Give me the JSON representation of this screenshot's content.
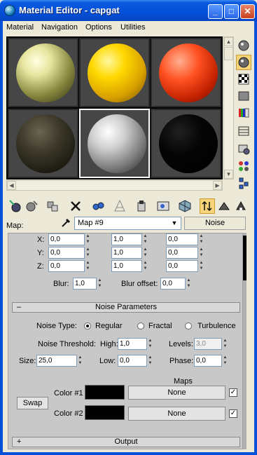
{
  "window": {
    "title": "Material Editor - capgat",
    "minimize": "_",
    "maximize": "□",
    "close": "✕"
  },
  "menu": [
    "Material",
    "Navigation",
    "Options",
    "Utilities"
  ],
  "map": {
    "label": "Map:",
    "current": "Map #9",
    "type_button": "Noise"
  },
  "coords": {
    "rows": [
      {
        "axis": "X:",
        "values": [
          "0,0",
          "1,0",
          "0,0"
        ]
      },
      {
        "axis": "Y:",
        "values": [
          "0,0",
          "1,0",
          "0,0"
        ]
      },
      {
        "axis": "Z:",
        "values": [
          "0,0",
          "1,0",
          "0,0"
        ]
      }
    ],
    "blur_label": "Blur:",
    "blur": "1,0",
    "blur_offset_label": "Blur offset:",
    "blur_offset": "0,0"
  },
  "noise": {
    "rollout_sign": "–",
    "rollout_title": "Noise Parameters",
    "type_label": "Noise Type:",
    "types": [
      "Regular",
      "Fractal",
      "Turbulence"
    ],
    "selected_type": "Regular",
    "threshold_label": "Noise Threshold:",
    "high_label": "High:",
    "high": "1,0",
    "levels_label": "Levels:",
    "levels": "3,0",
    "size_label": "Size:",
    "size": "25,0",
    "low_label": "Low:",
    "low": "0,0",
    "phase_label": "Phase:",
    "phase": "0,0",
    "maps_header": "Maps",
    "swap_button": "Swap",
    "color1_label": "Color #1",
    "color1_map": "None",
    "color2_label": "Color #2",
    "color2_map": "None",
    "color1_hex": "#000000",
    "color2_hex": "#000000"
  },
  "output": {
    "rollout_sign": "+",
    "rollout_title": "Output"
  },
  "colors": {
    "title_blue": "#0450d8",
    "window_bg": "#ece9d8",
    "panel_bg": "#c8c8c8"
  }
}
